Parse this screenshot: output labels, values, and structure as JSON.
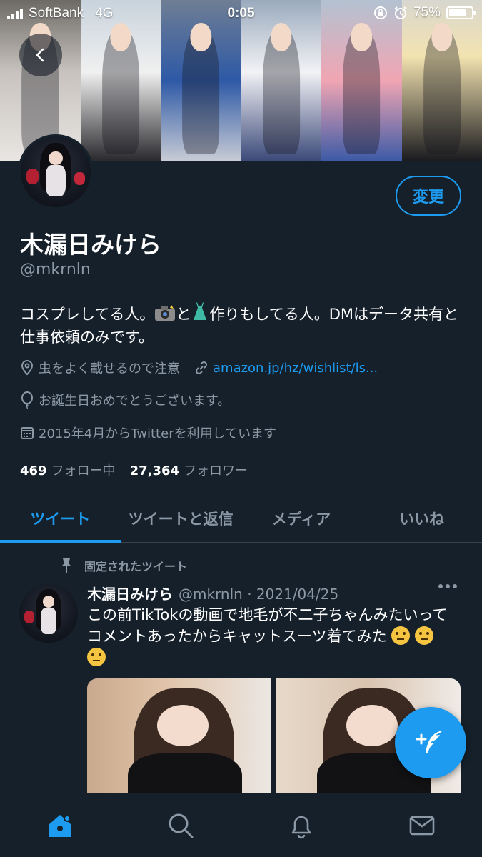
{
  "status_bar": {
    "carrier": "SoftBank",
    "network": "4G",
    "time": "0:05",
    "battery": "75%",
    "battery_level": 0.75
  },
  "profile": {
    "edit_label": "変更",
    "display_name": "木漏日みけら",
    "handle": "@mkrnln",
    "bio_part1": "コスプレしてる人。",
    "bio_part2": "と",
    "bio_part3": "作りもしてる人。DMはデータ共有と仕事依頼のみです。",
    "location": "虫をよく載せるので注意",
    "website": "amazon.jp/hz/wishlist/ls...",
    "birthday": "お誕生日おめでとうございます。",
    "joined": "2015年4月からTwitterを利用しています",
    "following_count": "469",
    "following_label": "フォロー中",
    "followers_count": "27,364",
    "followers_label": "フォロワー"
  },
  "tabs": [
    {
      "label": "ツイート",
      "active": true
    },
    {
      "label": "ツイートと返信",
      "active": false
    },
    {
      "label": "メディア",
      "active": false
    },
    {
      "label": "いいね",
      "active": false
    }
  ],
  "pinned_tweet": {
    "pinned_label": "固定されたツイート",
    "author_name": "木漏日みけら",
    "author_meta": "@mkrnln · 2021/04/25",
    "text": "この前TikTokの動画で地毛が不二子ちゃんみたいってコメントあったからキャットスーツ着てみた"
  },
  "icons": {
    "back": "chevron-left-icon",
    "location": "location-pin-icon",
    "link": "link-icon",
    "birthday": "balloon-icon",
    "calendar": "calendar-icon",
    "pin": "pin-icon",
    "more": "more-horizontal-icon",
    "compose": "compose-tweet-icon",
    "home": "home-icon",
    "search": "search-icon",
    "notifications": "bell-icon",
    "messages": "mail-icon"
  },
  "colors": {
    "background": "#15202b",
    "accent": "#1d9bf0",
    "secondary_text": "#8b98a5",
    "divider": "#38444d"
  }
}
